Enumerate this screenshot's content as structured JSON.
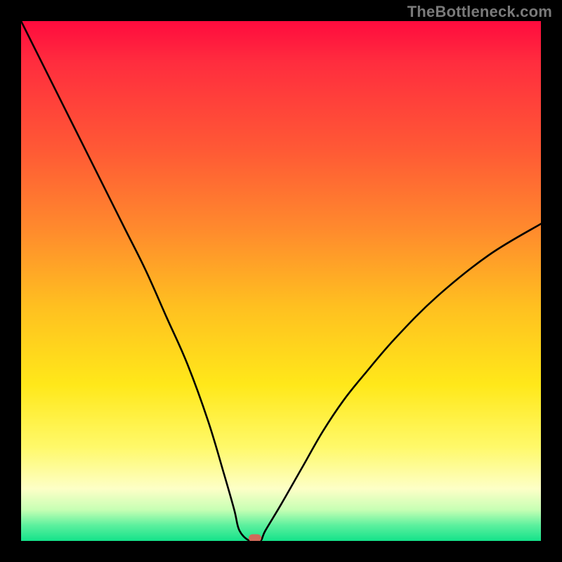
{
  "watermark_text": "TheBottleneck.com",
  "marker_color": "#d06a5a",
  "chart_data": {
    "type": "line",
    "title": "",
    "xlabel": "",
    "ylabel": "",
    "xlim": [
      0,
      100
    ],
    "ylim": [
      0,
      100
    ],
    "x_of_minimum": 44,
    "marker": {
      "x": 45,
      "y": 0.5,
      "color": "#d06a5a"
    },
    "series": [
      {
        "name": "bottleneck-curve",
        "x": [
          0,
          4,
          8,
          12,
          16,
          20,
          24,
          28,
          32,
          36,
          39,
          41,
          42,
          44,
          46,
          47,
          50,
          54,
          58,
          62,
          66,
          72,
          80,
          90,
          100
        ],
        "values": [
          100,
          92,
          84,
          76,
          68,
          60,
          52,
          43,
          34,
          23,
          13,
          6,
          2,
          0,
          0,
          2,
          7,
          14,
          21,
          27,
          32,
          39,
          47,
          55,
          61
        ]
      }
    ],
    "background_gradient_stops": [
      {
        "pos": 0.0,
        "color": "#ff0b3e"
      },
      {
        "pos": 0.25,
        "color": "#ff5a35"
      },
      {
        "pos": 0.55,
        "color": "#ffc020"
      },
      {
        "pos": 0.82,
        "color": "#fff96a"
      },
      {
        "pos": 0.94,
        "color": "#c7ffb4"
      },
      {
        "pos": 1.0,
        "color": "#14e28a"
      }
    ]
  }
}
